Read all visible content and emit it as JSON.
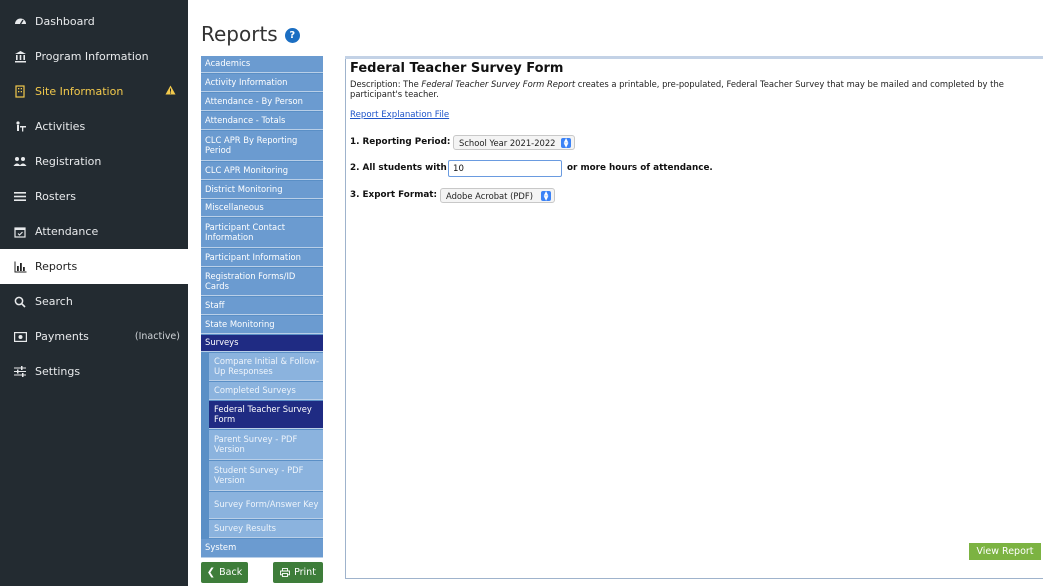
{
  "sidebar": {
    "items": [
      {
        "label": "Dashboard",
        "icon": "dashboard-icon"
      },
      {
        "label": "Program Information",
        "icon": "bank-icon"
      },
      {
        "label": "Site Information",
        "icon": "building-icon",
        "warning": "!"
      },
      {
        "label": "Activities",
        "icon": "activities-icon"
      },
      {
        "label": "Registration",
        "icon": "users-icon"
      },
      {
        "label": "Rosters",
        "icon": "list-icon"
      },
      {
        "label": "Attendance",
        "icon": "calendar-icon"
      },
      {
        "label": "Reports",
        "icon": "bar-chart-icon"
      },
      {
        "label": "Search",
        "icon": "search-icon"
      },
      {
        "label": "Payments",
        "icon": "money-icon",
        "tag": "(Inactive)"
      },
      {
        "label": "Settings",
        "icon": "sliders-icon"
      }
    ]
  },
  "page": {
    "title": "Reports",
    "help": "?"
  },
  "report_menu": {
    "items": [
      "Academics",
      "Activity Information",
      "Attendance - By Person",
      "Attendance - Totals",
      "CLC APR By Reporting Period",
      "CLC APR Monitoring",
      "District Monitoring",
      "Miscellaneous",
      "Participant Contact Information",
      "Participant Information",
      "Registration Forms/ID Cards",
      "Staff",
      "State Monitoring",
      "Surveys",
      "Compare Initial & Follow-Up Responses",
      "Completed Surveys",
      "Federal Teacher Survey Form",
      "Parent Survey - PDF Version",
      "Student Survey - PDF Version",
      "Survey Form/Answer Key",
      "Survey Results",
      "System"
    ],
    "back_label": "Back",
    "print_label": "Print"
  },
  "form": {
    "title": "Federal Teacher Survey Form",
    "desc_prefix": "Description: The ",
    "desc_em": "Federal Teacher Survey Form Report",
    "desc_suffix": " creates a printable, pre-populated, Federal Teacher Survey that may be mailed and completed by the participant's teacher.",
    "explanation_link": "Report Explanation File",
    "q1_label": "1. Reporting Period:",
    "q1_value": "School Year 2021-2022",
    "q2_label": "2. All students with",
    "q2_value": "10",
    "q2_suffix": "or more hours of attendance.",
    "q3_label": "3. Export Format:",
    "q3_value": "Adobe Acrobat (PDF)",
    "view_report": "View Report"
  },
  "colors": {
    "sidebar_bg": "#232b31",
    "warning": "#f2c94c",
    "menu_item": "#6b9bd0",
    "menu_sub": "#8bb3de",
    "menu_selected": "#1f2b83",
    "green_button": "#3e7d3a",
    "view_report": "#7cb342"
  }
}
